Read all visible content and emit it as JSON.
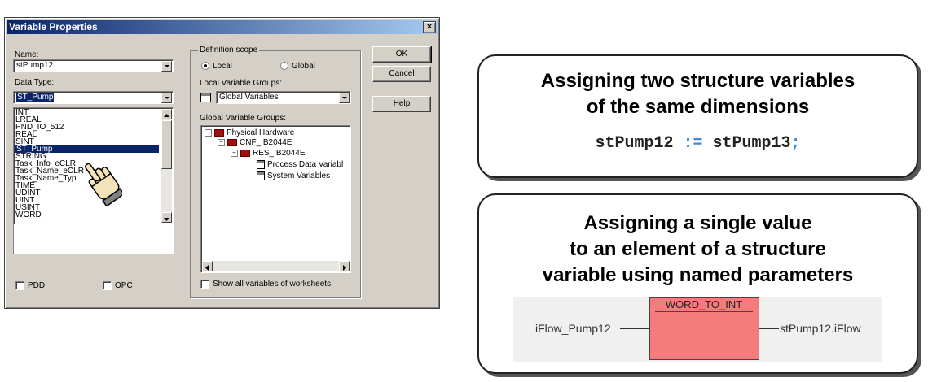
{
  "dialog": {
    "title": "Variable Properties",
    "close_glyph": "×",
    "name_label": "Name:",
    "name_value": "stPump12",
    "datatype_label": "Data Type:",
    "datatype_value": "ST_Pump",
    "datatype_options": [
      "INT",
      "LREAL",
      "PND_IO_512",
      "REAL",
      "SINT",
      "ST_Pump",
      "STRING",
      "Task_Info_eCLR",
      "Task_Name_eCLR",
      "Task_Name_Typ",
      "TIME",
      "UDINT",
      "UINT",
      "USINT",
      "WORD"
    ],
    "selected_option": "ST_Pump",
    "pdd_label": "PDD",
    "opc_label": "OPC",
    "scope_label": "Definition scope",
    "local_label": "Local",
    "global_label": "Global",
    "local_groups_label": "Local Variable Groups:",
    "local_groups_value": "Global Variables",
    "global_groups_label": "Global Variable Groups:",
    "tree": {
      "physical_hardware": "Physical Hardware",
      "cnf": "CNF_IB2044E",
      "res": "RES_IB2044E",
      "process_data": "Process Data Variabl",
      "system_vars": "System Variables"
    },
    "show_all_label": "Show all variables of worksheets",
    "ok_label": "OK",
    "cancel_label": "Cancel",
    "help_label": "Help"
  },
  "panel_top": {
    "title_line1": "Assigning two structure variables",
    "title_line2": "of the same dimensions",
    "code_left": "stPump12",
    "code_op": ":=",
    "code_right": "stPump13",
    "code_end": ";"
  },
  "panel_bottom": {
    "title_line1": "Assigning a single value",
    "title_line2": "to an element of a structure",
    "title_line3": "variable using named parameters",
    "block_name": "WORD_TO_INT",
    "input_var": "iFlow_Pump12",
    "output_var": "stPump12.iFlow"
  },
  "colors": {
    "title_bar": "#0a246a",
    "selection": "#0a246a",
    "function_block": "#f47c7c",
    "operator": "#3b8bd6"
  }
}
